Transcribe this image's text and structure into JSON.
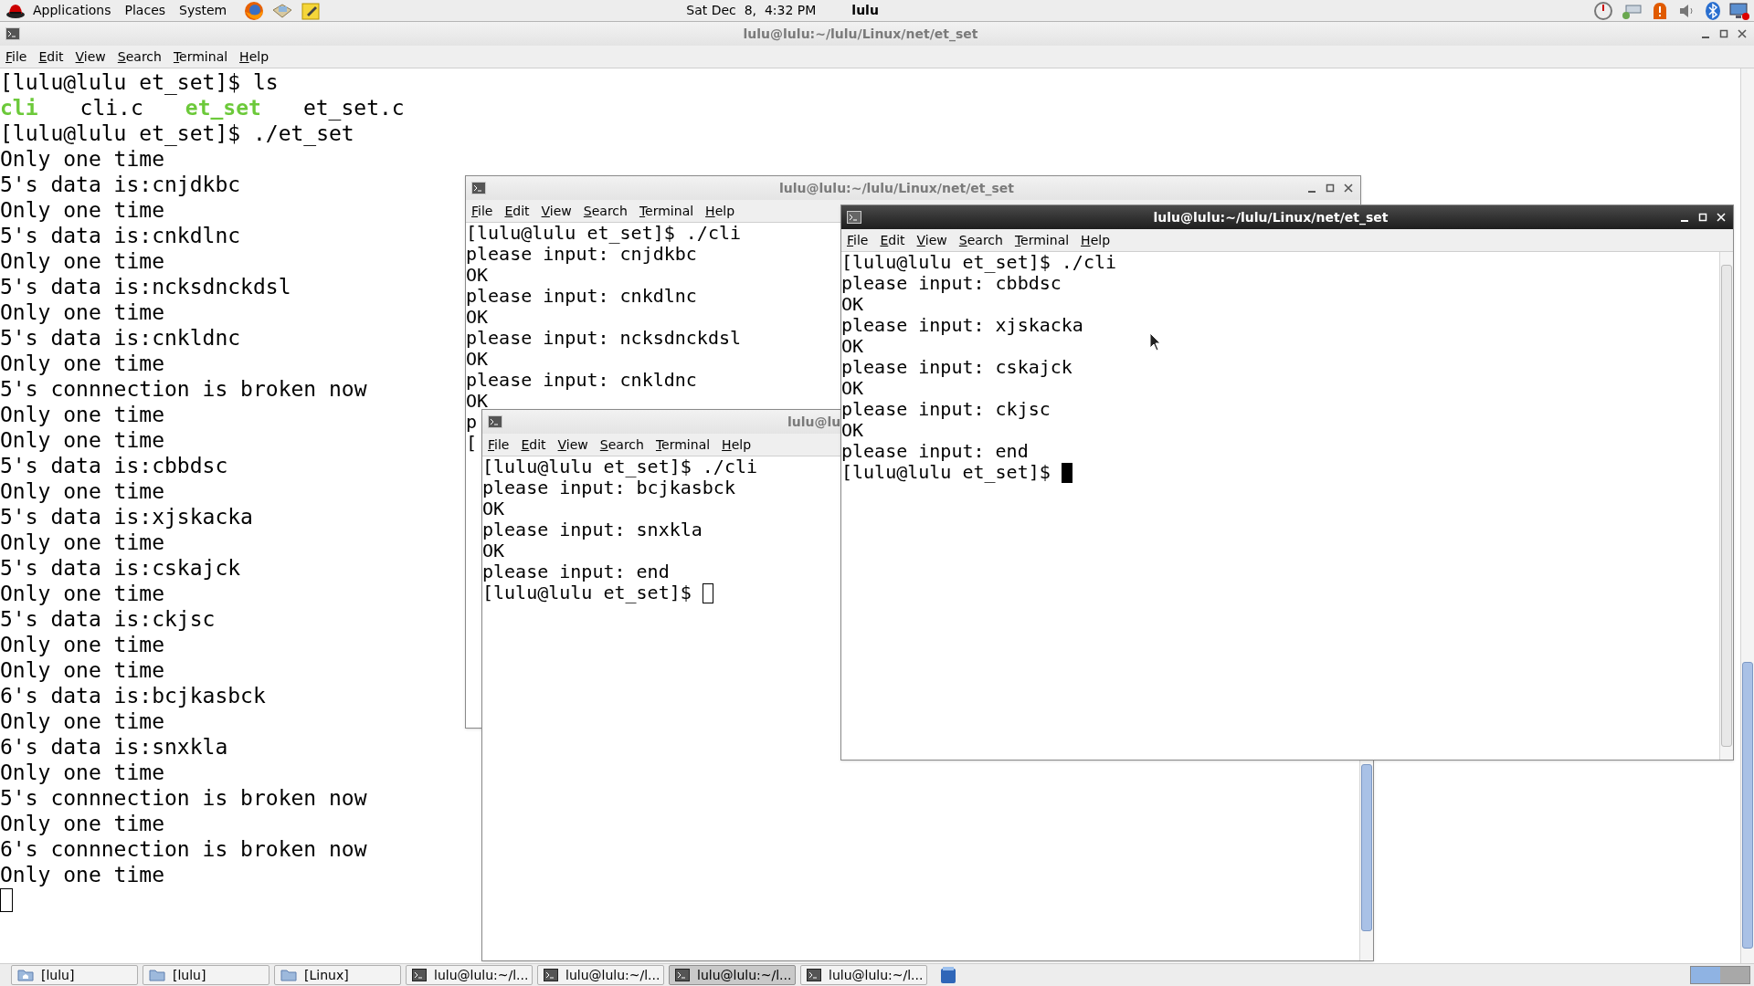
{
  "top_panel": {
    "menus": [
      "Applications",
      "Places",
      "System"
    ],
    "clock": "Sat Dec  8,  4:32 PM",
    "user": "lulu"
  },
  "windows": [
    {
      "title": "lulu@lulu:~/lulu/Linux/net/et_set",
      "active": false,
      "cursor": true,
      "menu": [
        "File",
        "Edit",
        "View",
        "Search",
        "Terminal",
        "Help"
      ],
      "lines": [
        "[lulu@lulu et_set]$ ls",
        {
          "kind": "listing",
          "entries": [
            {
              "name": "cli",
              "executable": true
            },
            {
              "name": "cli.c",
              "executable": false
            },
            {
              "name": "et_set",
              "executable": true
            },
            {
              "name": "et_set.c",
              "executable": false
            }
          ]
        },
        "[lulu@lulu et_set]$ ./et_set",
        "Only one time",
        "5's data is:cnjdkbc",
        "Only one time",
        "5's data is:cnkdlnc",
        "Only one time",
        "5's data is:ncksdnckdsl",
        "Only one time",
        "5's data is:cnkldnc",
        "Only one time",
        "5's connnection is broken now",
        "Only one time",
        "Only one time",
        "5's data is:cbbdsc",
        "Only one time",
        "5's data is:xjskacka",
        "Only one time",
        "5's data is:cskajck",
        "Only one time",
        "5's data is:ckjsc",
        "Only one time",
        "Only one time",
        "6's data is:bcjkasbck",
        "Only one time",
        "6's data is:snxkla",
        "Only one time",
        "5's connnection is broken now",
        "Only one time",
        "6's connnection is broken now",
        "Only one time",
        {
          "kind": "empty"
        }
      ]
    },
    {
      "title": "lulu@lulu:~/lulu/Linux/net/et_set",
      "active": false,
      "menu": [
        "File",
        "Edit",
        "View",
        "Search",
        "Terminal",
        "Help"
      ],
      "lines": [
        "[lulu@lulu et_set]$ ./cli",
        "please input: cnjdkbc",
        "OK",
        "please input: cnkdlnc",
        "OK",
        "please input: ncksdnckdsl",
        "OK",
        "please input: cnkldnc",
        "OK",
        "p",
        "["
      ]
    },
    {
      "title": "lulu@lu",
      "active": false,
      "cursor": true,
      "menu": [
        "File",
        "Edit",
        "View",
        "Search",
        "Terminal",
        "Help"
      ],
      "lines": [
        "[lulu@lulu et_set]$ ./cli",
        "please input: bcjkasbck",
        "OK",
        "please input: snxkla",
        "OK",
        "please input: end",
        "[lulu@lulu et_set]$ "
      ]
    },
    {
      "title": "lulu@lulu:~/lulu/Linux/net/et_set",
      "active": true,
      "cursor": true,
      "menu": [
        "File",
        "Edit",
        "View",
        "Search",
        "Terminal",
        "Help"
      ],
      "lines": [
        "[lulu@lulu et_set]$ ./cli",
        "please input: cbbdsc",
        "OK",
        "please input: xjskacka",
        "OK",
        "please input: cskajck",
        "OK",
        "please input: ckjsc",
        "OK",
        "please input: end",
        "[lulu@lulu et_set]$ "
      ]
    }
  ],
  "taskbar": {
    "items": [
      {
        "label": "[lulu]",
        "kind": "home",
        "selected": false
      },
      {
        "label": "[lulu]",
        "kind": "folder",
        "selected": false
      },
      {
        "label": "[Linux]",
        "kind": "folder",
        "selected": false
      },
      {
        "label": "lulu@lulu:~/l...",
        "kind": "terminal",
        "selected": false
      },
      {
        "label": "lulu@lulu:~/l...",
        "kind": "terminal",
        "selected": false
      },
      {
        "label": "lulu@lulu:~/l...",
        "kind": "terminal",
        "selected": true
      },
      {
        "label": "lulu@lulu:~/l...",
        "kind": "terminal",
        "selected": false
      }
    ]
  }
}
